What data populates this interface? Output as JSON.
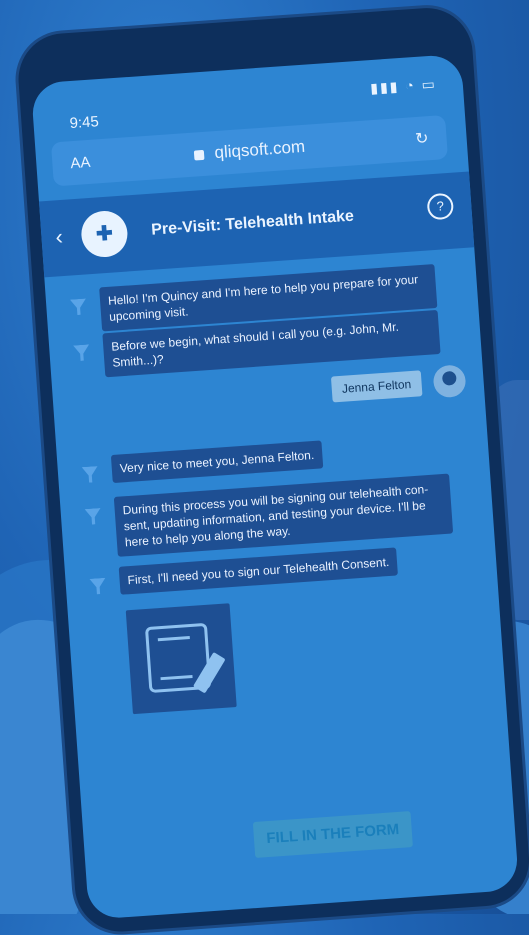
{
  "status": {
    "time": "9:45"
  },
  "browser": {
    "text_size_label": "AA",
    "url": "qliqsoft.com"
  },
  "header": {
    "title": "Pre-Visit: Telehealth Intake"
  },
  "chat": {
    "messages": [
      {
        "from": "bot",
        "text": "Hello! I'm Quincy and I'm here to help you prepare for your upcoming visit."
      },
      {
        "from": "bot",
        "text": "Before we begin, what should I call you (e.g. John, Mr. Smith...)?"
      },
      {
        "from": "user",
        "text": "Jenna Felton"
      },
      {
        "from": "bot",
        "text": "Very nice to meet you, Jenna Felton."
      },
      {
        "from": "bot",
        "text": "During this process you will be signing our telehealth con-sent, updating information, and testing your device. I'll be here to help you along the way."
      },
      {
        "from": "bot",
        "text": "First, I'll need you to sign our Telehealth Consent."
      }
    ]
  },
  "cta": {
    "label": "FILL IN THE FORM"
  },
  "colors": {
    "primary": "#1d63b2",
    "bubble": "#1e4f93",
    "cta": "#3b95c8"
  },
  "icons": [
    "back-icon",
    "logo-icon",
    "help-icon",
    "lock-icon",
    "reload-icon",
    "bot-icon",
    "avatar",
    "form-icon"
  ]
}
